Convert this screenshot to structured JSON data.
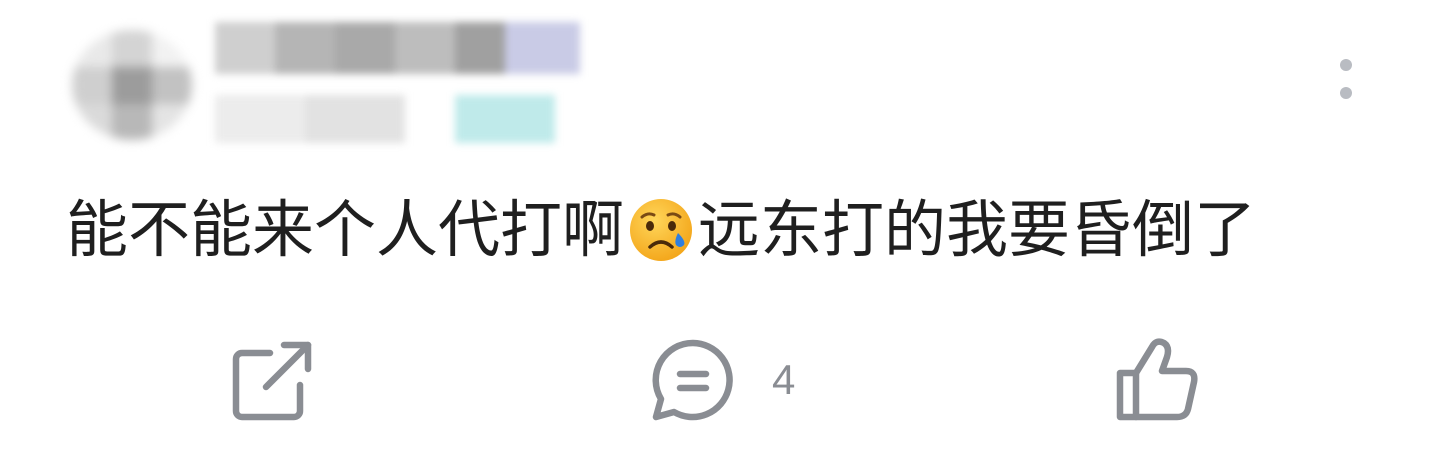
{
  "comment": {
    "text_before_emoji": "能不能来个人代打啊",
    "emoji": "crying-face-emoji",
    "text_after_emoji": "远东打的我要昏倒了"
  },
  "actions": {
    "share_icon": "share-icon",
    "comment_icon": "comment-bubble-icon",
    "comment_count": "4",
    "like_icon": "thumbs-up-icon"
  },
  "menu": {
    "more_icon": "more-vertical-icon"
  },
  "colors": {
    "icon_gray": "#8a8d93",
    "text": "#1f1f1f",
    "background": "#ffffff"
  }
}
